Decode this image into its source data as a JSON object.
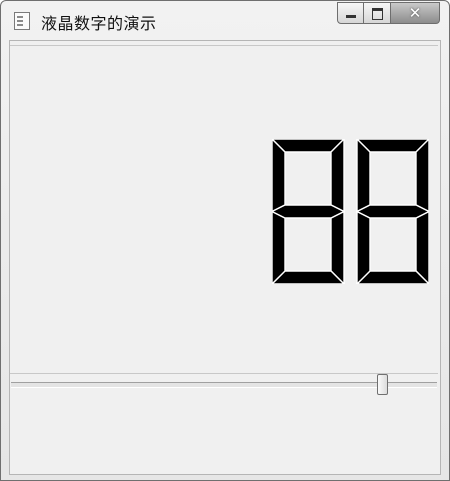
{
  "window": {
    "title": "液晶数字的演示",
    "app_icon": "app-window-icon",
    "buttons": {
      "minimize": "minimize-icon",
      "maximize": "maximize-icon",
      "close": "close-icon",
      "close_glyph": "✕"
    }
  },
  "lcd": {
    "value": "88",
    "digits": 2,
    "segment_style": "outline",
    "color": "#000000"
  },
  "slider": {
    "value_fraction": 0.88,
    "orientation": "horizontal"
  },
  "colors": {
    "background": "#f0f0f0",
    "border": "#b5b5b5"
  }
}
